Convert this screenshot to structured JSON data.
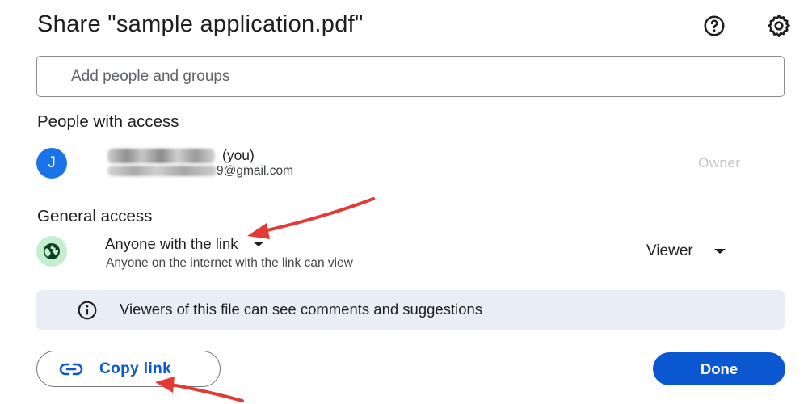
{
  "dialog": {
    "title": "Share \"sample application.pdf\"",
    "help_icon": "help-circle-icon",
    "settings_icon": "gear-icon"
  },
  "add_people": {
    "placeholder": "Add people and groups"
  },
  "people_section": {
    "heading": "People with access",
    "owner": {
      "avatar_letter": "J",
      "name_suffix": "(you)",
      "email_visible": "9@gmail.com",
      "role": "Owner"
    }
  },
  "general_access": {
    "heading": "General access",
    "icon": "globe-icon",
    "label": "Anyone with the link",
    "description": "Anyone on the internet with the link can view",
    "role": "Viewer"
  },
  "info_banner": {
    "icon": "info-icon",
    "text": "Viewers of this file can see comments and suggestions"
  },
  "footer": {
    "copy_link_icon": "link-icon",
    "copy_link_label": "Copy link",
    "done_label": "Done"
  },
  "colors": {
    "primary": "#0b57d0",
    "avatar": "#1a73e8",
    "globe_bg": "#c4eed0",
    "banner_bg": "#e9eef6",
    "annotation_arrow": "#e53935"
  }
}
